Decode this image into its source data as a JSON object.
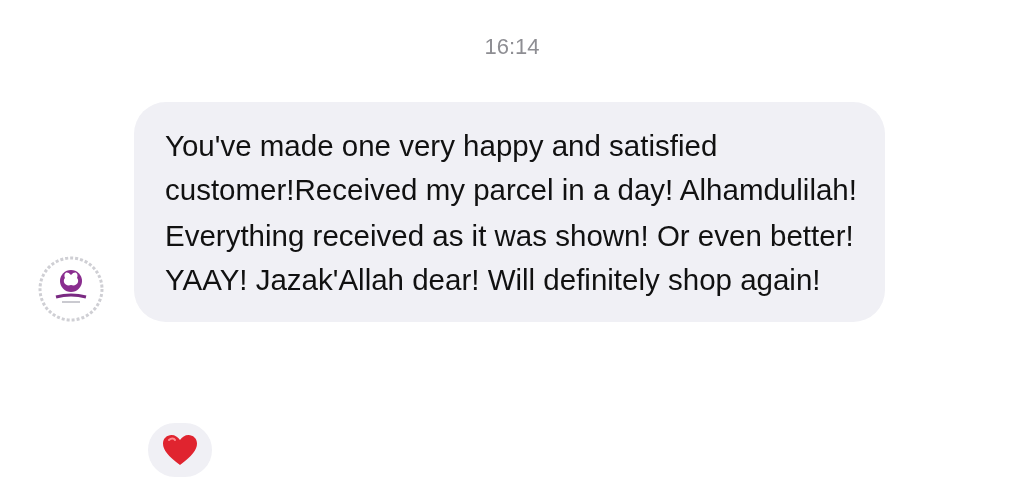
{
  "timestamp": "16:14",
  "message": {
    "paragraphs": [
      "You've made one very happy and satisfied customer!Received my parcel in a day! Alhamdulilah!",
      "Everything received as it was shown! Or even better! YAAY! Jazak'Allah dear! Will definitely shop again!"
    ],
    "reaction": {
      "kind": "heart"
    }
  }
}
